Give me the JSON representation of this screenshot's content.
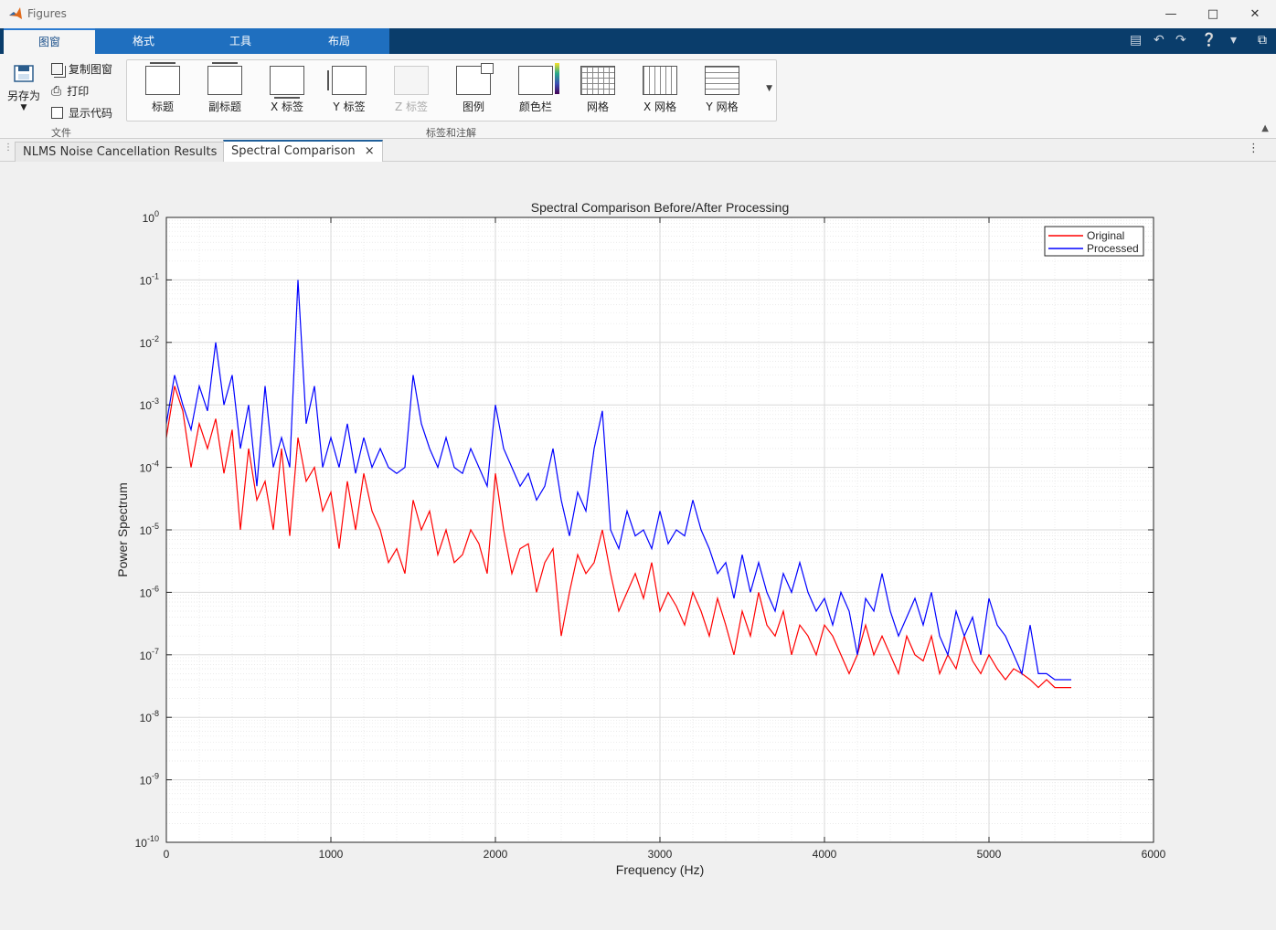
{
  "window": {
    "title": "Figures"
  },
  "ribbon_tabs": [
    "图窗",
    "格式",
    "工具",
    "布局"
  ],
  "file_group": {
    "save_as": "另存为",
    "copy_figure": "复制图窗",
    "print": "打印",
    "show_code": "显示代码",
    "group_label": "文件"
  },
  "labels_group": {
    "buttons": [
      "标题",
      "副标题",
      "X 标签",
      "Y 标签",
      "Z 标签",
      "图例",
      "颜色栏",
      "网格",
      "X 网格",
      "Y 网格"
    ],
    "disabled": [
      "Z 标签"
    ],
    "group_label": "标签和注解"
  },
  "doc_tabs": [
    {
      "label": "NLMS Noise Cancellation Results",
      "active": false
    },
    {
      "label": "Spectral Comparison",
      "active": true
    }
  ],
  "colors": {
    "original": "#ff0000",
    "processed": "#0000ff",
    "ribbon_dark": "#0a3d6b",
    "ribbon_blue": "#1f6fbf"
  },
  "chart_data": {
    "type": "line",
    "title": "Spectral Comparison Before/After Processing",
    "xlabel": "Frequency (Hz)",
    "ylabel": "Power Spectrum",
    "xlim": [
      0,
      6000
    ],
    "ylim": [
      1e-10,
      1
    ],
    "yscale": "log",
    "grid": true,
    "minor_grid": true,
    "legend_position": "top-right",
    "x_ticks": [
      "0",
      "1000",
      "2000",
      "3000",
      "4000",
      "5000",
      "6000"
    ],
    "y_ticks": [
      "10^-10",
      "10^-9",
      "10^-8",
      "10^-7",
      "10^-6",
      "10^-5",
      "10^-4",
      "10^-3",
      "10^-2",
      "10^-1",
      "10^0"
    ],
    "series": [
      {
        "name": "Original",
        "color": "#ff0000",
        "x": [
          0,
          50,
          100,
          150,
          200,
          250,
          300,
          350,
          400,
          450,
          500,
          550,
          600,
          650,
          700,
          750,
          800,
          850,
          900,
          950,
          1000,
          1050,
          1100,
          1150,
          1200,
          1250,
          1300,
          1350,
          1400,
          1450,
          1500,
          1550,
          1600,
          1650,
          1700,
          1750,
          1800,
          1850,
          1900,
          1950,
          2000,
          2050,
          2100,
          2150,
          2200,
          2250,
          2300,
          2350,
          2400,
          2450,
          2500,
          2550,
          2600,
          2650,
          2700,
          2750,
          2800,
          2850,
          2900,
          2950,
          3000,
          3050,
          3100,
          3150,
          3200,
          3250,
          3300,
          3350,
          3400,
          3450,
          3500,
          3550,
          3600,
          3650,
          3700,
          3750,
          3800,
          3850,
          3900,
          3950,
          4000,
          4050,
          4100,
          4150,
          4200,
          4250,
          4300,
          4350,
          4400,
          4450,
          4500,
          4550,
          4600,
          4650,
          4700,
          4750,
          4800,
          4850,
          4900,
          4950,
          5000,
          5050,
          5100,
          5150,
          5200,
          5250,
          5300,
          5350,
          5400,
          5450,
          5500
        ],
        "y": [
          0.0003,
          0.002,
          0.0008,
          0.0001,
          0.0005,
          0.0002,
          0.0006,
          8e-05,
          0.0004,
          1e-05,
          0.0002,
          3e-05,
          6e-05,
          1e-05,
          0.0002,
          8e-06,
          0.0003,
          6e-05,
          0.0001,
          2e-05,
          4e-05,
          5e-06,
          6e-05,
          1e-05,
          8e-05,
          2e-05,
          1e-05,
          3e-06,
          5e-06,
          2e-06,
          3e-05,
          1e-05,
          2e-05,
          4e-06,
          1e-05,
          3e-06,
          4e-06,
          1e-05,
          6e-06,
          2e-06,
          8e-05,
          1e-05,
          2e-06,
          5e-06,
          6e-06,
          1e-06,
          3e-06,
          5e-06,
          2e-07,
          1e-06,
          4e-06,
          2e-06,
          3e-06,
          1e-05,
          2e-06,
          5e-07,
          1e-06,
          2e-06,
          8e-07,
          3e-06,
          5e-07,
          1e-06,
          6e-07,
          3e-07,
          1e-06,
          5e-07,
          2e-07,
          8e-07,
          3e-07,
          1e-07,
          5e-07,
          2e-07,
          1e-06,
          3e-07,
          2e-07,
          5e-07,
          1e-07,
          3e-07,
          2e-07,
          1e-07,
          3e-07,
          2e-07,
          1e-07,
          5e-08,
          1e-07,
          3e-07,
          1e-07,
          2e-07,
          1e-07,
          5e-08,
          2e-07,
          1e-07,
          8e-08,
          2e-07,
          5e-08,
          1e-07,
          6e-08,
          2e-07,
          8e-08,
          5e-08,
          1e-07,
          6e-08,
          4e-08,
          6e-08,
          5e-08,
          4e-08,
          3e-08,
          4e-08,
          3e-08,
          3e-08,
          3e-08
        ]
      },
      {
        "name": "Processed",
        "color": "#0000ff",
        "x": [
          0,
          50,
          100,
          150,
          200,
          250,
          300,
          350,
          400,
          450,
          500,
          550,
          600,
          650,
          700,
          750,
          800,
          850,
          900,
          950,
          1000,
          1050,
          1100,
          1150,
          1200,
          1250,
          1300,
          1350,
          1400,
          1450,
          1500,
          1550,
          1600,
          1650,
          1700,
          1750,
          1800,
          1850,
          1900,
          1950,
          2000,
          2050,
          2100,
          2150,
          2200,
          2250,
          2300,
          2350,
          2400,
          2450,
          2500,
          2550,
          2600,
          2650,
          2700,
          2750,
          2800,
          2850,
          2900,
          2950,
          3000,
          3050,
          3100,
          3150,
          3200,
          3250,
          3300,
          3350,
          3400,
          3450,
          3500,
          3550,
          3600,
          3650,
          3700,
          3750,
          3800,
          3850,
          3900,
          3950,
          4000,
          4050,
          4100,
          4150,
          4200,
          4250,
          4300,
          4350,
          4400,
          4450,
          4500,
          4550,
          4600,
          4650,
          4700,
          4750,
          4800,
          4850,
          4900,
          4950,
          5000,
          5050,
          5100,
          5150,
          5200,
          5250,
          5300,
          5350,
          5400,
          5450,
          5500
        ],
        "y": [
          0.0005,
          0.003,
          0.001,
          0.0004,
          0.002,
          0.0008,
          0.01,
          0.001,
          0.003,
          0.0002,
          0.001,
          5e-05,
          0.002,
          0.0001,
          0.0003,
          0.0001,
          0.1,
          0.0005,
          0.002,
          0.0001,
          0.0003,
          0.0001,
          0.0005,
          8e-05,
          0.0003,
          0.0001,
          0.0002,
          0.0001,
          8e-05,
          0.0001,
          0.003,
          0.0005,
          0.0002,
          0.0001,
          0.0003,
          0.0001,
          8e-05,
          0.0002,
          0.0001,
          5e-05,
          0.001,
          0.0002,
          0.0001,
          5e-05,
          8e-05,
          3e-05,
          5e-05,
          0.0002,
          3e-05,
          8e-06,
          4e-05,
          2e-05,
          0.0002,
          0.0008,
          1e-05,
          5e-06,
          2e-05,
          8e-06,
          1e-05,
          5e-06,
          2e-05,
          6e-06,
          1e-05,
          8e-06,
          3e-05,
          1e-05,
          5e-06,
          2e-06,
          3e-06,
          8e-07,
          4e-06,
          1e-06,
          3e-06,
          1e-06,
          5e-07,
          2e-06,
          1e-06,
          3e-06,
          1e-06,
          5e-07,
          8e-07,
          3e-07,
          1e-06,
          5e-07,
          1e-07,
          8e-07,
          5e-07,
          2e-06,
          5e-07,
          2e-07,
          4e-07,
          8e-07,
          3e-07,
          1e-06,
          2e-07,
          1e-07,
          5e-07,
          2e-07,
          4e-07,
          1e-07,
          8e-07,
          3e-07,
          2e-07,
          1e-07,
          5e-08,
          3e-07,
          5e-08,
          5e-08,
          4e-08,
          4e-08,
          4e-08
        ]
      }
    ]
  }
}
